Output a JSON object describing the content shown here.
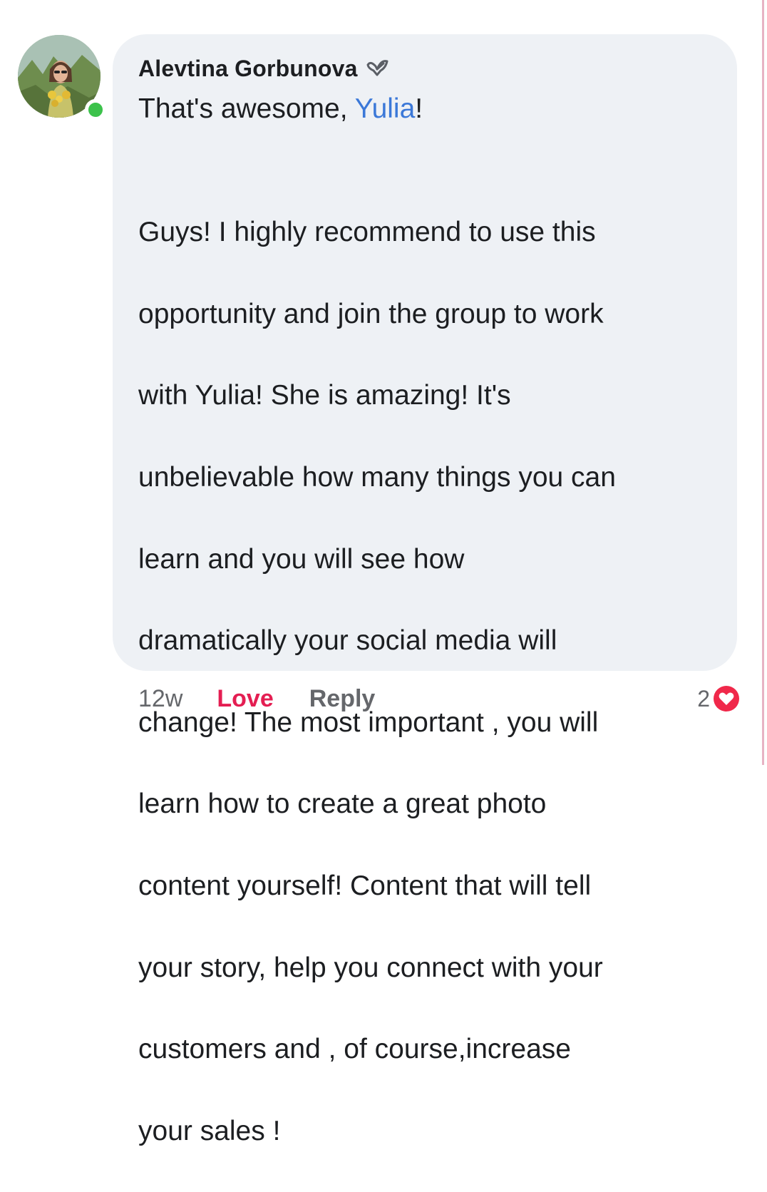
{
  "comment": {
    "author": "Alevtina Gorbunova",
    "badge_icon": "rising-star-badge-icon",
    "greeting_prefix": "That's awesome, ",
    "mention": "Yulia",
    "greeting_suffix": "!",
    "body_lines": [
      "Guys! I highly recommend to use this",
      "opportunity and join the group to work",
      "with Yulia! She is amazing! It's",
      "unbelievable how many things you can",
      "learn and you will see how",
      "dramatically your social media will",
      "change! The most important , you will",
      "learn how to create a great photo",
      "content yourself! Content that will tell",
      "your story, help you connect with your",
      "customers and , of course,increase",
      "your sales !"
    ]
  },
  "actions": {
    "timestamp": "12w",
    "love_label": "Love",
    "reply_label": "Reply"
  },
  "reaction": {
    "count": "2",
    "icon": "heart-icon"
  },
  "colors": {
    "bubble": "#eef1f5",
    "mention": "#3b78d8",
    "love": "#e41e52",
    "online": "#3cc24b",
    "muted": "#65676b"
  }
}
